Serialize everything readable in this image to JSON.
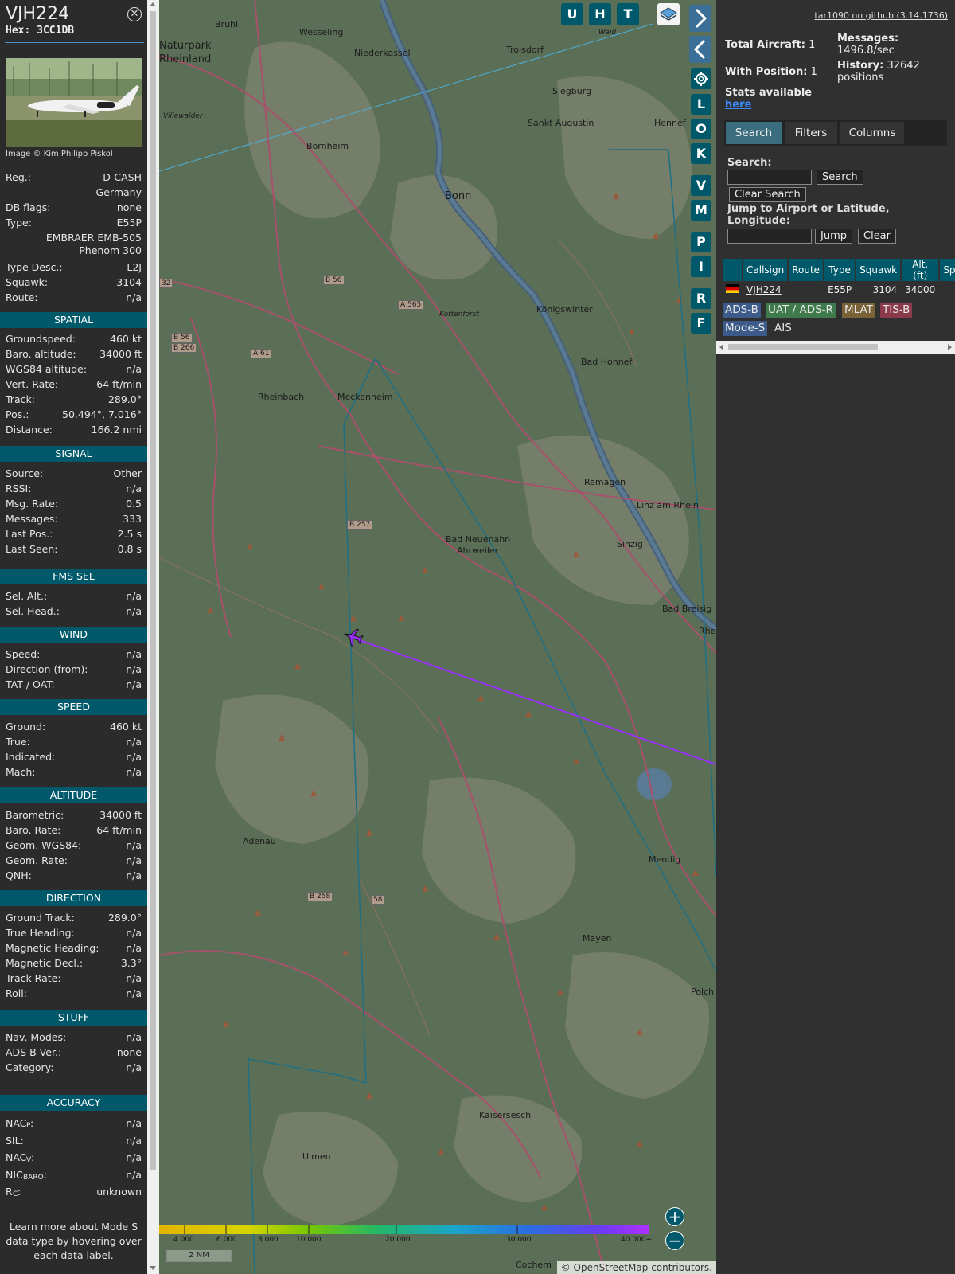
{
  "selected": {
    "callsign": "VJH224",
    "hex": "Hex: 3CC1DB",
    "image_caption": "Image © Kim Philipp Piskol",
    "registration_label": "Reg.:",
    "registration": "D-CASH",
    "country": "Germany",
    "dbflags_label": "DB flags:",
    "dbflags": "none",
    "type_label": "Type:",
    "type": "E55P",
    "type_full_1": "EMBRAER EMB-505",
    "type_full_2": "Phenom 300",
    "type_desc_label": "Type Desc.:",
    "type_desc": "L2J",
    "squawk_label": "Squawk:",
    "squawk": "3104",
    "route_label": "Route:",
    "route": "n/a",
    "learn_more_1": "Learn more about Mode S",
    "learn_more_2": "data type by hovering over",
    "learn_more_3": "each data label."
  },
  "sections": {
    "spatial": {
      "title": "SPATIAL",
      "rows": [
        {
          "k": "Groundspeed:",
          "v": "460 kt"
        },
        {
          "k": "Baro. altitude:",
          "v": "34000 ft"
        },
        {
          "k": "WGS84 altitude:",
          "v": "n/a"
        },
        {
          "k": "Vert. Rate:",
          "v": "64 ft/min"
        },
        {
          "k": "Track:",
          "v": "289.0°"
        },
        {
          "k": "Pos.:",
          "v": "50.494°, 7.016°"
        },
        {
          "k": "Distance:",
          "v": "166.2 nmi"
        }
      ]
    },
    "signal": {
      "title": "SIGNAL",
      "rows": [
        {
          "k": "Source:",
          "v": "Other"
        },
        {
          "k": "RSSI:",
          "v": "n/a"
        },
        {
          "k": "Msg. Rate:",
          "v": "0.5"
        },
        {
          "k": "Messages:",
          "v": "333"
        },
        {
          "k": "Last Pos.:",
          "v": "2.5 s"
        },
        {
          "k": "Last Seen:",
          "v": "0.8 s"
        }
      ]
    },
    "fms": {
      "title": "FMS SEL",
      "rows": [
        {
          "k": "Sel. Alt.:",
          "v": "n/a"
        },
        {
          "k": "Sel. Head.:",
          "v": "n/a"
        }
      ]
    },
    "wind": {
      "title": "WIND",
      "rows": [
        {
          "k": "Speed:",
          "v": "n/a"
        },
        {
          "k": "Direction (from):",
          "v": "n/a"
        },
        {
          "k": "TAT / OAT:",
          "v": "n/a"
        }
      ]
    },
    "speed": {
      "title": "SPEED",
      "rows": [
        {
          "k": "Ground:",
          "v": "460 kt"
        },
        {
          "k": "True:",
          "v": "n/a"
        },
        {
          "k": "Indicated:",
          "v": "n/a"
        },
        {
          "k": "Mach:",
          "v": "n/a"
        }
      ]
    },
    "altitude": {
      "title": "ALTITUDE",
      "rows": [
        {
          "k": "Barometric:",
          "v": "34000 ft"
        },
        {
          "k": "Baro. Rate:",
          "v": "64 ft/min"
        },
        {
          "k": "Geom. WGS84:",
          "v": "n/a"
        },
        {
          "k": "Geom. Rate:",
          "v": "n/a"
        },
        {
          "k": "QNH:",
          "v": "n/a"
        }
      ]
    },
    "direction": {
      "title": "DIRECTION",
      "rows": [
        {
          "k": "Ground Track:",
          "v": "289.0°"
        },
        {
          "k": "True Heading:",
          "v": "n/a"
        },
        {
          "k": "Magnetic Heading:",
          "v": "n/a"
        },
        {
          "k": "Magnetic Decl.:",
          "v": "3.3°"
        },
        {
          "k": "Track Rate:",
          "v": "n/a"
        },
        {
          "k": "Roll:",
          "v": "n/a"
        }
      ]
    },
    "stuff": {
      "title": "STUFF",
      "rows": [
        {
          "k": "Nav. Modes:",
          "v": "n/a"
        },
        {
          "k": "ADS-B Ver.:",
          "v": "none"
        },
        {
          "k": "Category:",
          "v": "n/a"
        }
      ]
    },
    "accuracy": {
      "title": "ACCURACY",
      "rows": [
        {
          "k": "NAC",
          "sub": "P",
          "v": "n/a"
        },
        {
          "k": "SIL:",
          "v": "n/a"
        },
        {
          "k": "NAC",
          "sub": "V",
          "v": "n/a"
        },
        {
          "k": "NIC",
          "sub": "BARO",
          "v": "n/a"
        },
        {
          "k": "R",
          "sub": "C",
          "v": "unknown"
        }
      ]
    }
  },
  "map": {
    "layer_buttons": [
      "U",
      "H",
      "T"
    ],
    "side_buttons": [
      "L",
      "O",
      "K",
      "V",
      "M",
      "P",
      "I",
      "R",
      "F"
    ],
    "places": [
      {
        "name": "Naturpark",
        "big": true
      },
      {
        "name": "Rheinland",
        "big": true
      },
      {
        "name": "Brühl"
      },
      {
        "name": "Wesseling"
      },
      {
        "name": "Niederkassel"
      },
      {
        "name": "Troisdorf"
      },
      {
        "name": "Siegburg"
      },
      {
        "name": "Sankt Augustin"
      },
      {
        "name": "Hennef"
      },
      {
        "name": "Villewalder"
      },
      {
        "name": "Bornheim"
      },
      {
        "name": "Bonn",
        "big": true
      },
      {
        "name": "Königswinter"
      },
      {
        "name": "Kottenforst"
      },
      {
        "name": "Bad Honnef"
      },
      {
        "name": "Rheinbach"
      },
      {
        "name": "Meckenheim"
      },
      {
        "name": "Remagen"
      },
      {
        "name": "Linz am Rhein"
      },
      {
        "name": "Bad Neuenahr-"
      },
      {
        "name": "Ahrweiler"
      },
      {
        "name": "Sinzig"
      },
      {
        "name": "Bad Breisig"
      },
      {
        "name": "Rhe"
      },
      {
        "name": "Adenau"
      },
      {
        "name": "Mendig"
      },
      {
        "name": "Mayen"
      },
      {
        "name": "Polch"
      },
      {
        "name": "Kaisersesch"
      },
      {
        "name": "Ulmen"
      },
      {
        "name": "Cochem"
      },
      {
        "name": "Waid"
      }
    ],
    "road_tags": [
      "B 56",
      "A 565",
      "B 56",
      "B 266",
      "A 61",
      "B 257",
      "B 258",
      "32",
      "58"
    ],
    "altitude_scale": [
      "4 000",
      "6 000",
      "8 000",
      "10 000",
      "20 000",
      "30 000",
      "40 000+"
    ],
    "scale_text": "2 NM",
    "attribution_prefix": "© ",
    "attribution_link": "OpenStreetMap",
    "attribution_suffix": " contributors.",
    "zoom_in": "+",
    "zoom_out": "−"
  },
  "right": {
    "github": "tar1090 on github (3.14.1736)",
    "total_label": "Total Aircraft:",
    "total": "1",
    "withpos_label": "With Position:",
    "withpos": "1",
    "stats_label": "Stats available",
    "stats_link": "here",
    "messages_label": "Messages:",
    "messages": "1496.8/sec",
    "history_label": "History:",
    "history": "32642",
    "history_unit": "positions",
    "tabs": [
      "Search",
      "Filters",
      "Columns"
    ],
    "search_label": "Search:",
    "search_btn": "Search",
    "clear_search_btn": "Clear Search",
    "jump_label_1": "Jump to Airport or Latitude,",
    "jump_label_2": "Longitude:",
    "jump_btn": "Jump",
    "clear_btn": "Clear",
    "table": {
      "headers": [
        "Callsign",
        "Route",
        "Type",
        "Squawk",
        "Alt. (ft)",
        "Spd."
      ],
      "rows": [
        {
          "callsign": "VJH224",
          "route": "",
          "type": "E55P",
          "squawk": "3104",
          "alt": "34000"
        }
      ]
    },
    "sources": [
      {
        "label": "ADS-B",
        "color": "#3c5a8a"
      },
      {
        "label": "UAT / ADS-R",
        "color": "#3f7a4c"
      },
      {
        "label": "MLAT",
        "color": "#7a6238"
      },
      {
        "label": "TIS-B",
        "color": "#8a3a4a"
      },
      {
        "label": "Mode-S",
        "color": "#3c5a8a"
      },
      {
        "label": "AIS",
        "color": ""
      }
    ]
  }
}
